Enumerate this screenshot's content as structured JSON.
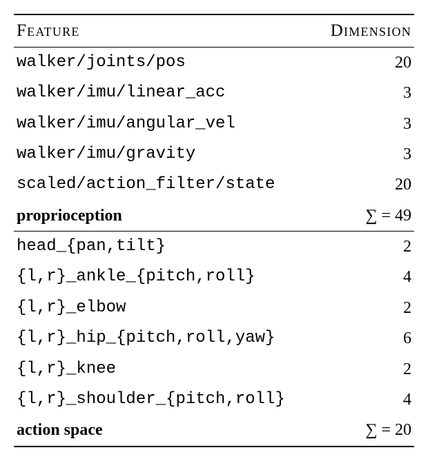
{
  "header": {
    "feature": "Feature",
    "dimension": "Dimension"
  },
  "sections": [
    {
      "rows": [
        {
          "feature": "walker/joints/pos",
          "dim": "20"
        },
        {
          "feature": "walker/imu/linear_acc",
          "dim": "3"
        },
        {
          "feature": "walker/imu/angular_vel",
          "dim": "3"
        },
        {
          "feature": "walker/imu/gravity",
          "dim": "3"
        },
        {
          "feature": "scaled/action_filter/state",
          "dim": "20"
        }
      ],
      "summary": {
        "label": "proprioception",
        "value": "∑ = 49"
      }
    },
    {
      "rows": [
        {
          "feature": "head_{pan,tilt}",
          "dim": "2"
        },
        {
          "feature": "{l,r}_ankle_{pitch,roll}",
          "dim": "4"
        },
        {
          "feature": "{l,r}_elbow",
          "dim": "2"
        },
        {
          "feature": "{l,r}_hip_{pitch,roll,yaw}",
          "dim": "6"
        },
        {
          "feature": "{l,r}_knee",
          "dim": "2"
        },
        {
          "feature": "{l,r}_shoulder_{pitch,roll}",
          "dim": "4"
        }
      ],
      "summary": {
        "label": "action space",
        "value": "∑ = 20"
      }
    }
  ],
  "chart_data": {
    "type": "table",
    "title": "",
    "columns": [
      "Feature",
      "Dimension"
    ],
    "groups": [
      {
        "name": "proprioception",
        "rows": [
          [
            "walker/joints/pos",
            20
          ],
          [
            "walker/imu/linear_acc",
            3
          ],
          [
            "walker/imu/angular_vel",
            3
          ],
          [
            "walker/imu/gravity",
            3
          ],
          [
            "scaled/action_filter/state",
            20
          ]
        ],
        "total": 49
      },
      {
        "name": "action space",
        "rows": [
          [
            "head_{pan,tilt}",
            2
          ],
          [
            "{l,r}_ankle_{pitch,roll}",
            4
          ],
          [
            "{l,r}_elbow",
            2
          ],
          [
            "{l,r}_hip_{pitch,roll,yaw}",
            6
          ],
          [
            "{l,r}_knee",
            2
          ],
          [
            "{l,r}_shoulder_{pitch,roll}",
            4
          ]
        ],
        "total": 20
      }
    ]
  }
}
